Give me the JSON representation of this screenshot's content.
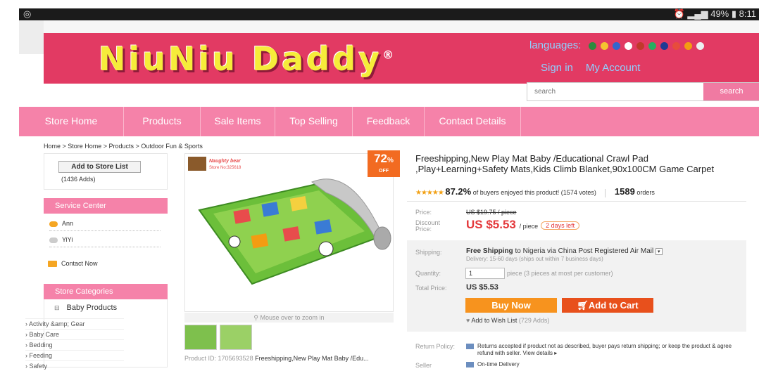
{
  "status_bar": {
    "time": "8:11",
    "battery": "49%"
  },
  "logo": {
    "text": "NiuNiu Daddy",
    "mark": "®"
  },
  "header": {
    "languages_label": "languages:",
    "sign_in": "Sign in",
    "my_account": "My Account",
    "search_placeholder": "search",
    "search_button": "search"
  },
  "nav": [
    {
      "label": "Store Home"
    },
    {
      "label": "Products"
    },
    {
      "label": "Sale Items"
    },
    {
      "label": "Top Selling"
    },
    {
      "label": "Feedback"
    },
    {
      "label": "Contact Details"
    }
  ],
  "breadcrumb": "Home > Store Home > Products > Outdoor Fun & Sports",
  "sidebar": {
    "add_store": "Add to Store List",
    "adds": "(1436 Adds)",
    "service_title": "Service Center",
    "service": [
      {
        "name": "Ann"
      },
      {
        "name": "YiYi"
      }
    ],
    "contact": "Contact Now",
    "categories_title": "Store Categories",
    "category_main": "Baby Products",
    "subcats": [
      "› Activity &amp; Gear",
      "› Baby Care",
      "› Bedding",
      "› Feeding",
      "› Safety"
    ]
  },
  "product": {
    "store_brand": "Naughty bear",
    "store_no": "Store No:325618",
    "discount_pct": "72",
    "discount_unit": "%",
    "discount_word": "OFF",
    "zoom_hint": "Mouse over to zoom in",
    "id_label": "Product ID: 1705693528",
    "id_title": "Freeshipping,New Play Mat Baby /Edu...",
    "title": "Freeshipping,New Play Mat Baby /Educational Crawl Pad ,Play+Learning+Safety Mats,Kids Climb Blanket,90x100CM Game Carpet",
    "rating_pct": "87.2%",
    "rating_text": "of buyers enjoyed this product! (1574 votes)",
    "orders": "1589",
    "orders_label": "orders",
    "price_label": "Price:",
    "old_price": "US $19.75 / piece",
    "discount_label": "Discount Price:",
    "new_price": "US $5.53",
    "per_piece": "/ piece",
    "days_left": "2 days left",
    "shipping_label": "Shipping:",
    "shipping_bold": "Free Shipping",
    "shipping_to": "to  Nigeria via China Post Registered Air Mail",
    "delivery": "Delivery: 15-60 days (ships out within 7 business days)",
    "quantity_label": "Quantity:",
    "quantity": "1",
    "qty_hint": "piece (3 pieces at most per customer)",
    "total_label": "Total Price:",
    "total": "US $5.53",
    "buy_now": "Buy Now",
    "add_cart": "Add to Cart",
    "wish": "Add to Wish List",
    "wish_count": "(729 Adds)",
    "return_label": "Return Policy:",
    "return_text": "Returns accepted if product not as described, buyer pays return shipping; or keep the product & agree refund with seller. View details ▸",
    "seller_label": "Seller",
    "seller_text": "On-time Delivery"
  },
  "colors": {
    "banner": "#e23a63",
    "nav": "#f582a9",
    "price": "#e4393c",
    "buy": "#f7931e",
    "cart": "#e8501c"
  }
}
